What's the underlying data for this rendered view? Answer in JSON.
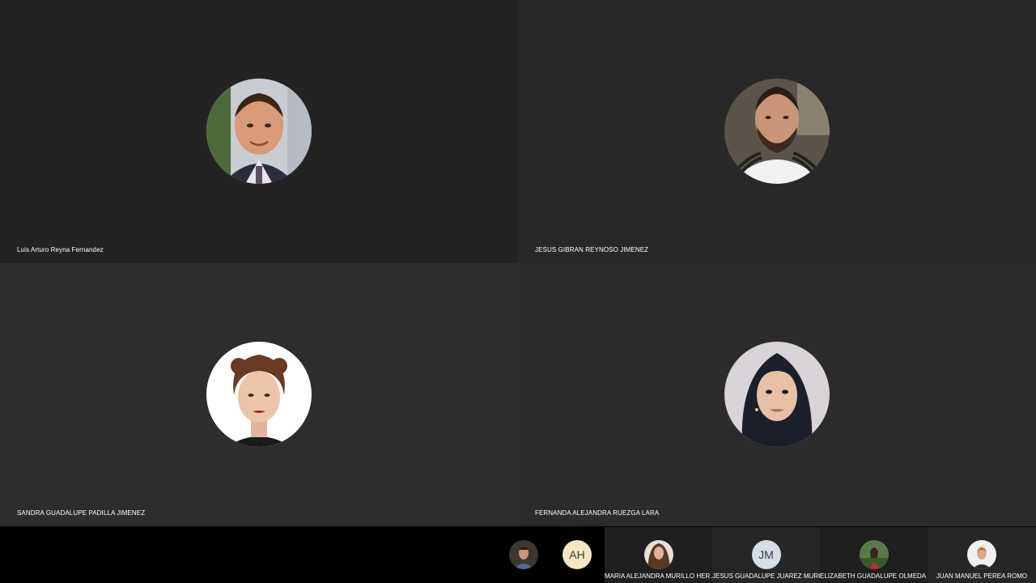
{
  "participants": [
    {
      "name": "Luis Arturo Reyna Fernandez",
      "bg": "#232323"
    },
    {
      "name": "JESUS GIBRAN REYNOSO JIMENEZ",
      "bg": "#282828"
    },
    {
      "name": "SANDRA GUADALUPE PADILLA JIMENEZ",
      "bg": "#2d2d2d"
    },
    {
      "name": "FERNANDA ALEJANDRA RUEZGA LARA",
      "bg": "#2b2b2b"
    }
  ],
  "strip": [
    {
      "type": "photo",
      "name": ""
    },
    {
      "type": "initials",
      "initials": "AH",
      "name": "",
      "color": "#f6e6c4"
    },
    {
      "type": "photo",
      "name": "MARIA  ALEJANDRA  MURILLO HER..."
    },
    {
      "type": "initials",
      "initials": "JM",
      "name": "JESUS GUADALUPE JUAREZ MURG...",
      "color": "#d6dde5"
    },
    {
      "type": "photo",
      "name": "ELIZABETH GUADALUPE OLMEDA L..."
    },
    {
      "type": "photo",
      "name": "JUAN MANUEL PEREA ROMO"
    }
  ]
}
